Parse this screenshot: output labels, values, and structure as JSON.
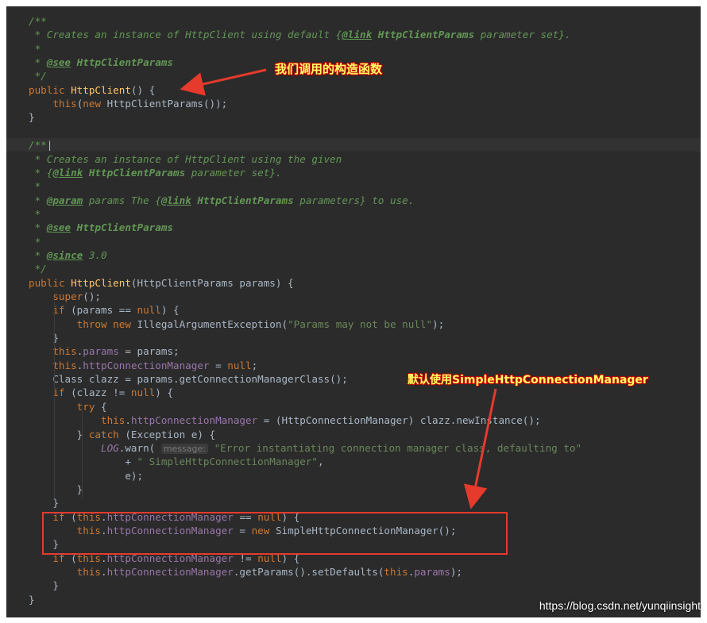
{
  "code_lines": [
    [
      [
        "c",
        "/**"
      ]
    ],
    [
      [
        "c",
        " * Creates an instance of HttpClient using default {"
      ],
      [
        "ct",
        "@link"
      ],
      [
        "cb",
        " HttpClientParams"
      ],
      [
        "c",
        " parameter set}."
      ]
    ],
    [
      [
        "c",
        " *"
      ]
    ],
    [
      [
        "c",
        " * "
      ],
      [
        "ct",
        "@see"
      ],
      [
        "cb",
        " HttpClientParams"
      ]
    ],
    [
      [
        "c",
        " */"
      ]
    ],
    [
      [
        "kw",
        "public "
      ],
      [
        "fn",
        "HttpClient"
      ],
      [
        "pl",
        "() {"
      ]
    ],
    [
      [
        "pl",
        "    "
      ],
      [
        "kw",
        "this"
      ],
      [
        "pl",
        "("
      ],
      [
        "kw",
        "new "
      ],
      [
        "pl",
        "HttpClientParams());"
      ]
    ],
    [
      [
        "pl",
        "}"
      ]
    ],
    [
      [
        "pl",
        ""
      ]
    ],
    [
      [
        "c",
        "/**"
      ],
      [
        "pl",
        "|"
      ]
    ],
    [
      [
        "c",
        " * Creates an instance of HttpClient using the given"
      ]
    ],
    [
      [
        "c",
        " * {"
      ],
      [
        "ct",
        "@link"
      ],
      [
        "cb",
        " HttpClientParams"
      ],
      [
        "c",
        " parameter set}."
      ]
    ],
    [
      [
        "c",
        " *"
      ]
    ],
    [
      [
        "c",
        " * "
      ],
      [
        "ct",
        "@param"
      ],
      [
        "c",
        " params The {"
      ],
      [
        "ct",
        "@link"
      ],
      [
        "cb",
        " HttpClientParams"
      ],
      [
        "c",
        " parameters} to use."
      ]
    ],
    [
      [
        "c",
        " *"
      ]
    ],
    [
      [
        "c",
        " * "
      ],
      [
        "ct",
        "@see"
      ],
      [
        "cb",
        " HttpClientParams"
      ]
    ],
    [
      [
        "c",
        " *"
      ]
    ],
    [
      [
        "c",
        " * "
      ],
      [
        "ct",
        "@since"
      ],
      [
        "c",
        " 3.0"
      ]
    ],
    [
      [
        "c",
        " */"
      ]
    ],
    [
      [
        "kw",
        "public "
      ],
      [
        "fn",
        "HttpClient"
      ],
      [
        "pl",
        "(HttpClientParams params) {"
      ]
    ],
    [
      [
        "pl",
        "    "
      ],
      [
        "kw",
        "super"
      ],
      [
        "pl",
        "();"
      ]
    ],
    [
      [
        "pl",
        "    "
      ],
      [
        "kw",
        "if "
      ],
      [
        "pl",
        "(params == "
      ],
      [
        "kw",
        "null"
      ],
      [
        "pl",
        ") {"
      ]
    ],
    [
      [
        "pl",
        "        "
      ],
      [
        "kw",
        "throw new "
      ],
      [
        "pl",
        "IllegalArgumentException("
      ],
      [
        "st",
        "\"Params may not be null\""
      ],
      [
        "pl",
        ");"
      ]
    ],
    [
      [
        "pl",
        "    }"
      ]
    ],
    [
      [
        "pl",
        "    "
      ],
      [
        "kw",
        "this"
      ],
      [
        "pl",
        "."
      ],
      [
        "fld",
        "params"
      ],
      [
        "pl",
        " = params;"
      ]
    ],
    [
      [
        "pl",
        "    "
      ],
      [
        "kw",
        "this"
      ],
      [
        "pl",
        "."
      ],
      [
        "fld",
        "httpConnectionManager"
      ],
      [
        "pl",
        " = "
      ],
      [
        "kw",
        "null"
      ],
      [
        "pl",
        ";"
      ]
    ],
    [
      [
        "pl",
        "    Class clazz = params.getConnectionManagerClass();"
      ]
    ],
    [
      [
        "pl",
        "    "
      ],
      [
        "kw",
        "if "
      ],
      [
        "pl",
        "(clazz != "
      ],
      [
        "kw",
        "null"
      ],
      [
        "pl",
        ") {"
      ]
    ],
    [
      [
        "pl",
        "        "
      ],
      [
        "kw",
        "try "
      ],
      [
        "pl",
        "{"
      ]
    ],
    [
      [
        "pl",
        "            "
      ],
      [
        "kw",
        "this"
      ],
      [
        "pl",
        "."
      ],
      [
        "fld",
        "httpConnectionManager"
      ],
      [
        "pl",
        " = (HttpConnectionManager) clazz.newInstance();"
      ]
    ],
    [
      [
        "pl",
        "        } "
      ],
      [
        "kw",
        "catch "
      ],
      [
        "pl",
        "(Exception e) {"
      ]
    ],
    [
      [
        "pl",
        "            "
      ],
      [
        "sf",
        "LOG"
      ],
      [
        "pl",
        ".warn( "
      ],
      [
        "hint",
        "message:"
      ],
      [
        "pl",
        " "
      ],
      [
        "st",
        "\"Error instantiating connection manager class, defaulting to\""
      ]
    ],
    [
      [
        "pl",
        "                + "
      ],
      [
        "st",
        "\" SimpleHttpConnectionManager\""
      ],
      [
        "pl",
        ","
      ]
    ],
    [
      [
        "pl",
        "                e);"
      ]
    ],
    [
      [
        "pl",
        "        }"
      ]
    ],
    [
      [
        "pl",
        "    }"
      ]
    ],
    [
      [
        "pl",
        "    "
      ],
      [
        "kw",
        "if "
      ],
      [
        "pl",
        "("
      ],
      [
        "kw",
        "this"
      ],
      [
        "pl",
        "."
      ],
      [
        "fld",
        "httpConnectionManager"
      ],
      [
        "pl",
        " == "
      ],
      [
        "kw",
        "null"
      ],
      [
        "pl",
        ") {"
      ]
    ],
    [
      [
        "pl",
        "        "
      ],
      [
        "kw",
        "this"
      ],
      [
        "pl",
        "."
      ],
      [
        "fld",
        "httpConnectionManager"
      ],
      [
        "pl",
        " = "
      ],
      [
        "kw",
        "new "
      ],
      [
        "pl",
        "SimpleHttpConnectionManager();"
      ]
    ],
    [
      [
        "pl",
        "    }"
      ]
    ],
    [
      [
        "pl",
        "    "
      ],
      [
        "kw",
        "if "
      ],
      [
        "pl",
        "("
      ],
      [
        "kw",
        "this"
      ],
      [
        "pl",
        "."
      ],
      [
        "fld",
        "httpConnectionManager"
      ],
      [
        "pl",
        " != "
      ],
      [
        "kw",
        "null"
      ],
      [
        "pl",
        ") {"
      ]
    ],
    [
      [
        "pl",
        "        "
      ],
      [
        "kw",
        "this"
      ],
      [
        "pl",
        "."
      ],
      [
        "fld",
        "httpConnectionManager"
      ],
      [
        "pl",
        ".getParams().setDefaults("
      ],
      [
        "kw",
        "this"
      ],
      [
        "pl",
        "."
      ],
      [
        "fld",
        "params"
      ],
      [
        "pl",
        ");"
      ]
    ],
    [
      [
        "pl",
        "    }"
      ]
    ],
    [
      [
        "pl",
        "}"
      ]
    ]
  ],
  "annotations": {
    "constructor_note": "我们调用的构造函数",
    "default_note": "默认使用SimpleHttpConnectionManager"
  },
  "watermark": "https://blog.csdn.net/yunqiinsight",
  "colors": {
    "background": "#2b2b2b",
    "comment": "#629755",
    "keyword": "#cc7832",
    "method": "#ffc66d",
    "field": "#9876aa",
    "string": "#6a8759",
    "plain": "#a9b7c6",
    "annotation_arrow": "#e53a2c"
  }
}
